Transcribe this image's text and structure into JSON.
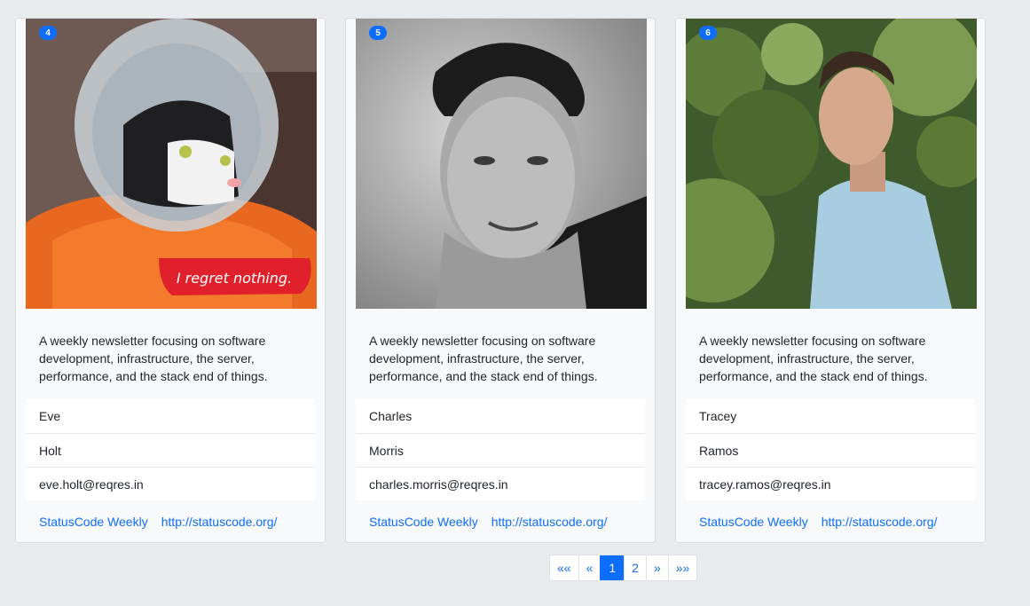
{
  "pagination": {
    "first": "««",
    "prev": "«",
    "pages": [
      "1",
      "2"
    ],
    "active_page": "1",
    "next": "»",
    "last": "»»"
  },
  "cards": [
    {
      "id": "4",
      "description": "A weekly newsletter focusing on software development, infrastructure, the server, performance, and the stack end of things.",
      "first_name": "Eve",
      "last_name": "Holt",
      "email": "eve.holt@reqres.in",
      "link_text": "StatusCode Weekly",
      "link_url": "http://statuscode.org/",
      "photo_caption": "I regret nothing."
    },
    {
      "id": "5",
      "description": "A weekly newsletter focusing on software development, infrastructure, the server, performance, and the stack end of things.",
      "first_name": "Charles",
      "last_name": "Morris",
      "email": "charles.morris@reqres.in",
      "link_text": "StatusCode Weekly",
      "link_url": "http://statuscode.org/"
    },
    {
      "id": "6",
      "description": "A weekly newsletter focusing on software development, infrastructure, the server, performance, and the stack end of things.",
      "first_name": "Tracey",
      "last_name": "Ramos",
      "email": "tracey.ramos@reqres.in",
      "link_text": "StatusCode Weekly",
      "link_url": "http://statuscode.org/"
    }
  ]
}
